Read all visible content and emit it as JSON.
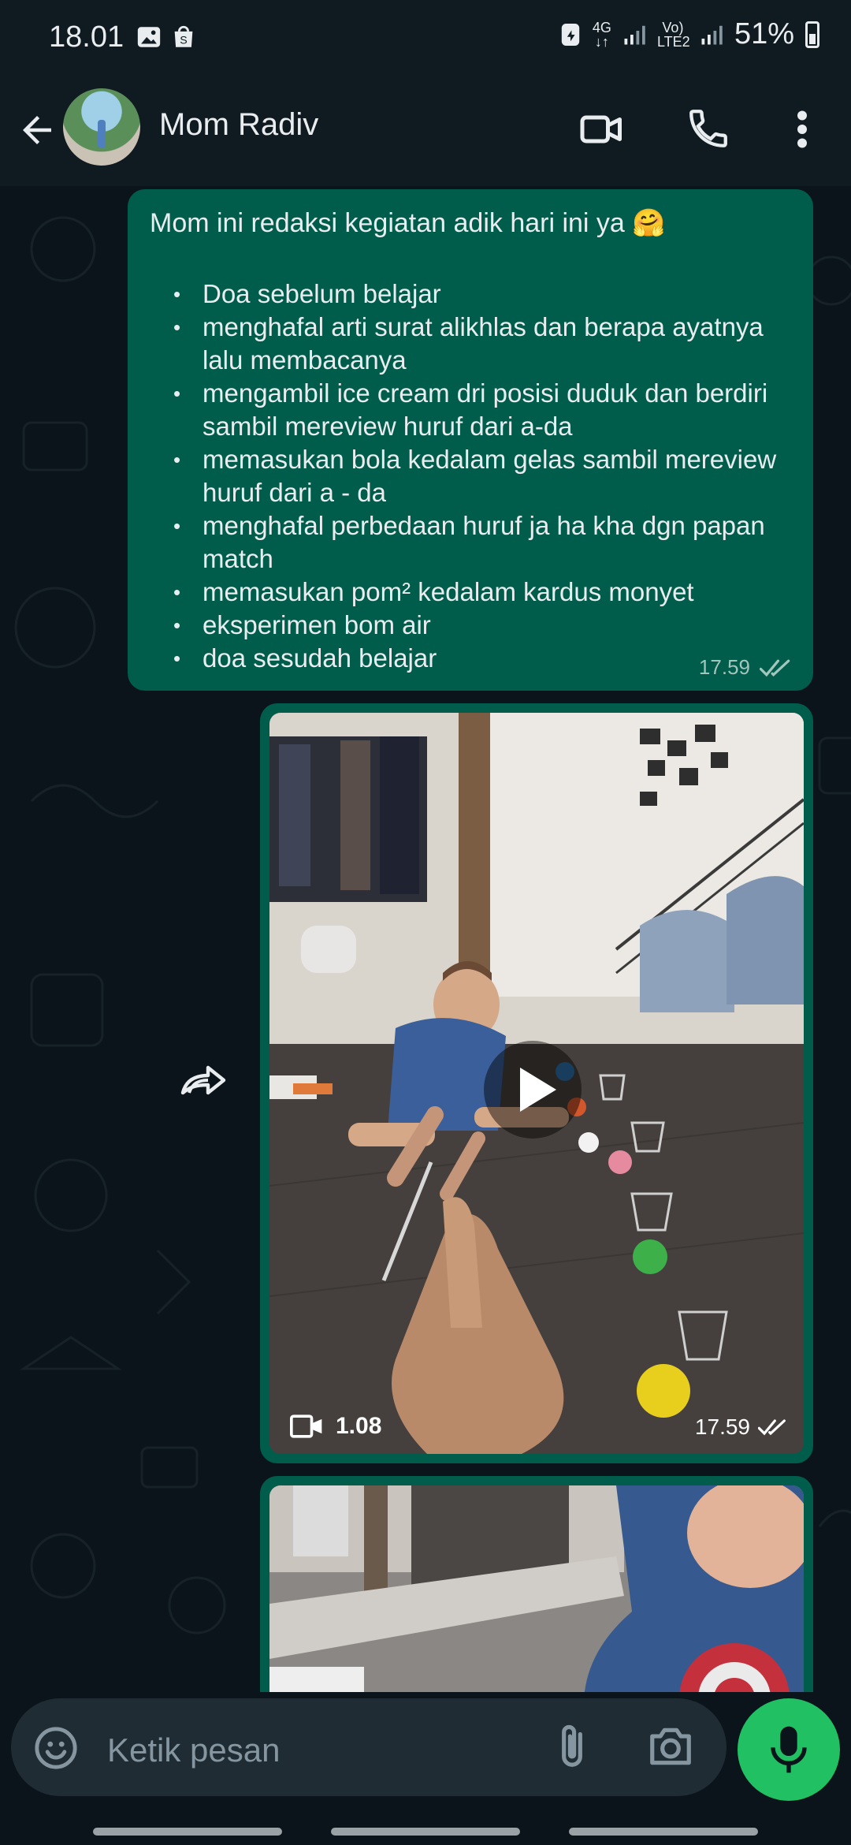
{
  "status_bar": {
    "time": "18.01",
    "network": "4G",
    "volte": "Vo) LTE2",
    "battery": "51%",
    "icons": [
      "gallery-icon",
      "shop-icon",
      "data-saver-icon",
      "signal-icon"
    ]
  },
  "header": {
    "contact_name": "Mom Radiv",
    "icons": [
      "back-arrow-icon",
      "video-call-icon",
      "voice-call-icon",
      "more-icon"
    ]
  },
  "messages": [
    {
      "type": "text",
      "title": "Mom ini redaksi kegiatan adik hari ini ya 🤗",
      "items": [
        "Doa sebelum belajar",
        "menghafal arti surat alikhlas dan berapa ayatnya lalu membacanya",
        "mengambil ice cream dri posisi duduk dan berdiri sambil mereview huruf dari a-da",
        "memasukan bola kedalam gelas sambil mereview huruf dari a - da",
        "menghafal perbedaan huruf ja ha kha dgn papan match",
        "memasukan pom² kedalam kardus monyet",
        "eksperimen bom air",
        "doa sesudah belajar"
      ],
      "time": "17.59",
      "read": true
    },
    {
      "type": "video",
      "duration": "1.08",
      "time": "17.59",
      "read": true
    },
    {
      "type": "video-partial"
    }
  ],
  "composer": {
    "placeholder": "Ketik pesan"
  },
  "colors": {
    "background": "#0b141a",
    "bar": "#0f1a21",
    "outgoing_bubble": "#005c4b",
    "mic_button": "#21c063"
  }
}
